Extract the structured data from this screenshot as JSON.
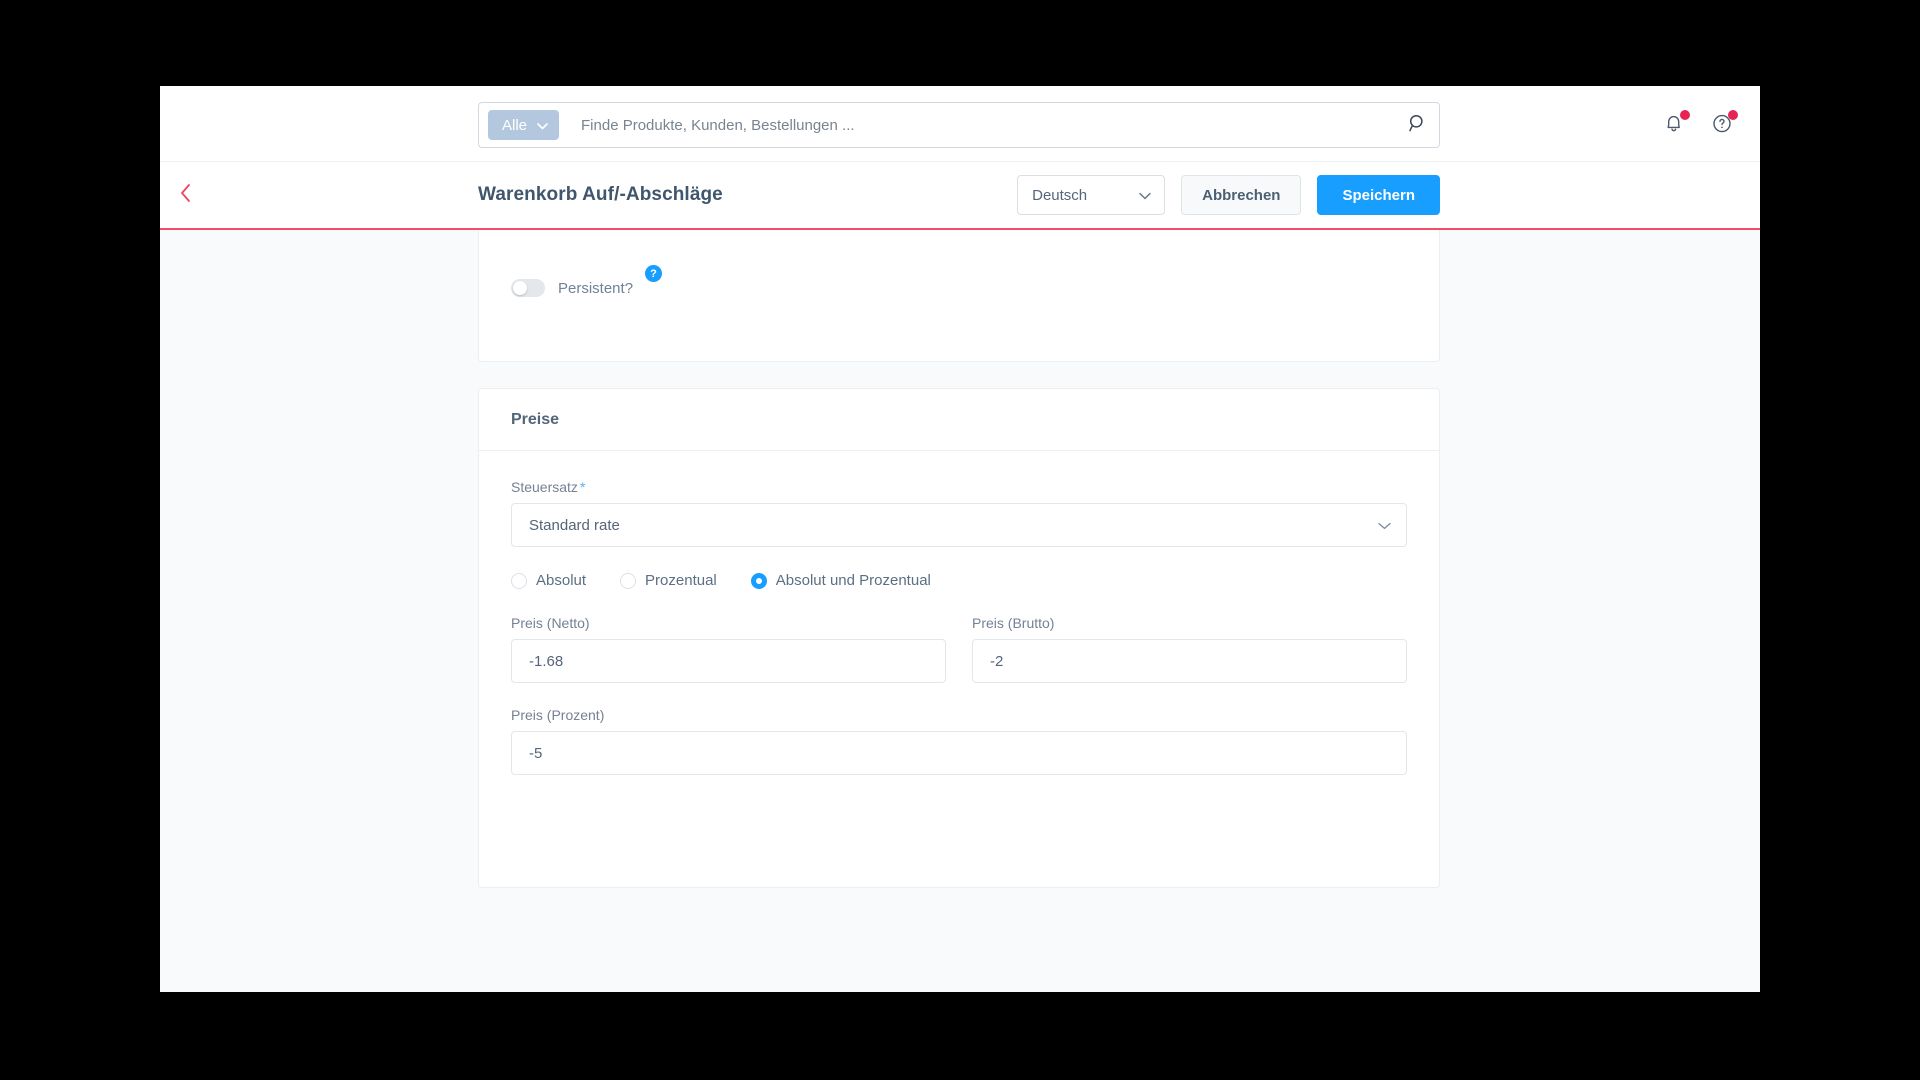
{
  "topbar": {
    "scope_label": "Alle",
    "search_placeholder": "Finde Produkte, Kunden, Bestellungen ...",
    "search_value": "",
    "search_icon": "search-icon",
    "notifications_icon": "bell-icon",
    "help_icon": "question-circle-icon"
  },
  "pageheader": {
    "back_icon": "chevron-left-icon",
    "title": "Warenkorb Auf/-Abschläge",
    "language": "Deutsch",
    "language_chevron": "chevron-down-icon",
    "cancel_label": "Abbrechen",
    "save_label": "Speichern"
  },
  "persistent_card": {
    "toggle_label": "Persistent?",
    "toggle_state": "off",
    "help_glyph": "?"
  },
  "prices_card": {
    "title": "Preise",
    "tax_label": "Steuersatz",
    "tax_required_marker": "*",
    "tax_value": "Standard rate",
    "tax_chevron": "chevron-down-icon",
    "radios": [
      {
        "label": "Absolut",
        "checked": false
      },
      {
        "label": "Prozentual",
        "checked": false
      },
      {
        "label": "Absolut und Prozentual",
        "checked": true
      }
    ],
    "net_label": "Preis (Netto)",
    "net_value": "-1.68",
    "gross_label": "Preis (Brutto)",
    "gross_value": "-2",
    "percent_label": "Preis (Prozent)",
    "percent_value": "-5"
  },
  "colors": {
    "primary_blue": "#189eff",
    "accent_pink": "#f44d6c",
    "badge_red": "#e52653",
    "pill_blue": "#b3c8de",
    "page_bg": "#f9fafb"
  }
}
